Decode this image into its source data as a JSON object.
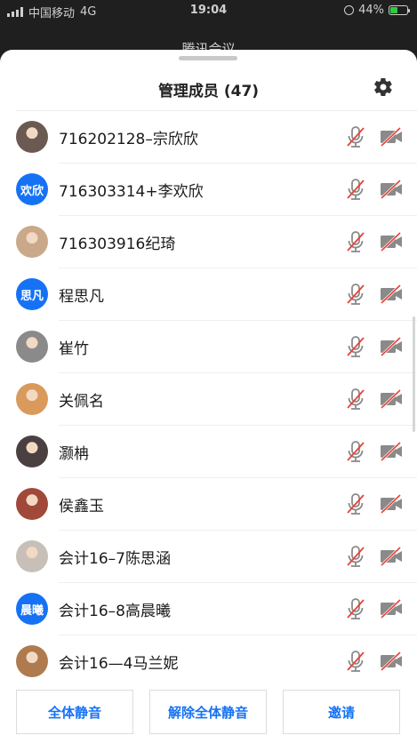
{
  "status_bar": {
    "carrier": "中国移动",
    "network": "4G",
    "time": "19:04",
    "battery": "44%",
    "battery_level": 0.44
  },
  "background_title": "腾讯会议",
  "sheet": {
    "title": "管理成员 (47)",
    "settings_icon": "gear-icon"
  },
  "members": [
    {
      "name": "716202128–宗欣欣",
      "avatar_type": "photo",
      "avatar_color": "#6b5a52"
    },
    {
      "name": "716303314+李欢欣",
      "avatar_type": "text",
      "avatar_text": "欢欣"
    },
    {
      "name": "716303916纪琦",
      "avatar_type": "photo",
      "avatar_color": "#c9a98a"
    },
    {
      "name": "程思凡",
      "avatar_type": "text",
      "avatar_text": "思凡"
    },
    {
      "name": "崔竹",
      "avatar_type": "photo",
      "avatar_color": "#8a8a8a"
    },
    {
      "name": "关佩名",
      "avatar_type": "photo",
      "avatar_color": "#d99a5b"
    },
    {
      "name": "灏柟",
      "avatar_type": "photo",
      "avatar_color": "#4a4040"
    },
    {
      "name": "侯鑫玉",
      "avatar_type": "photo",
      "avatar_color": "#a0493a"
    },
    {
      "name": "会计16–7陈思涵",
      "avatar_type": "photo",
      "avatar_color": "#c8c0b8"
    },
    {
      "name": "会计16–8高晨曦",
      "avatar_type": "text",
      "avatar_text": "晨曦"
    },
    {
      "name": "会计16—4马兰妮",
      "avatar_type": "photo",
      "avatar_color": "#b07a4f"
    }
  ],
  "footer": {
    "mute_all": "全体静音",
    "unmute_all": "解除全体静音",
    "invite": "邀请"
  },
  "colors": {
    "accent": "#1672f5",
    "muted_red": "#e8423a"
  }
}
